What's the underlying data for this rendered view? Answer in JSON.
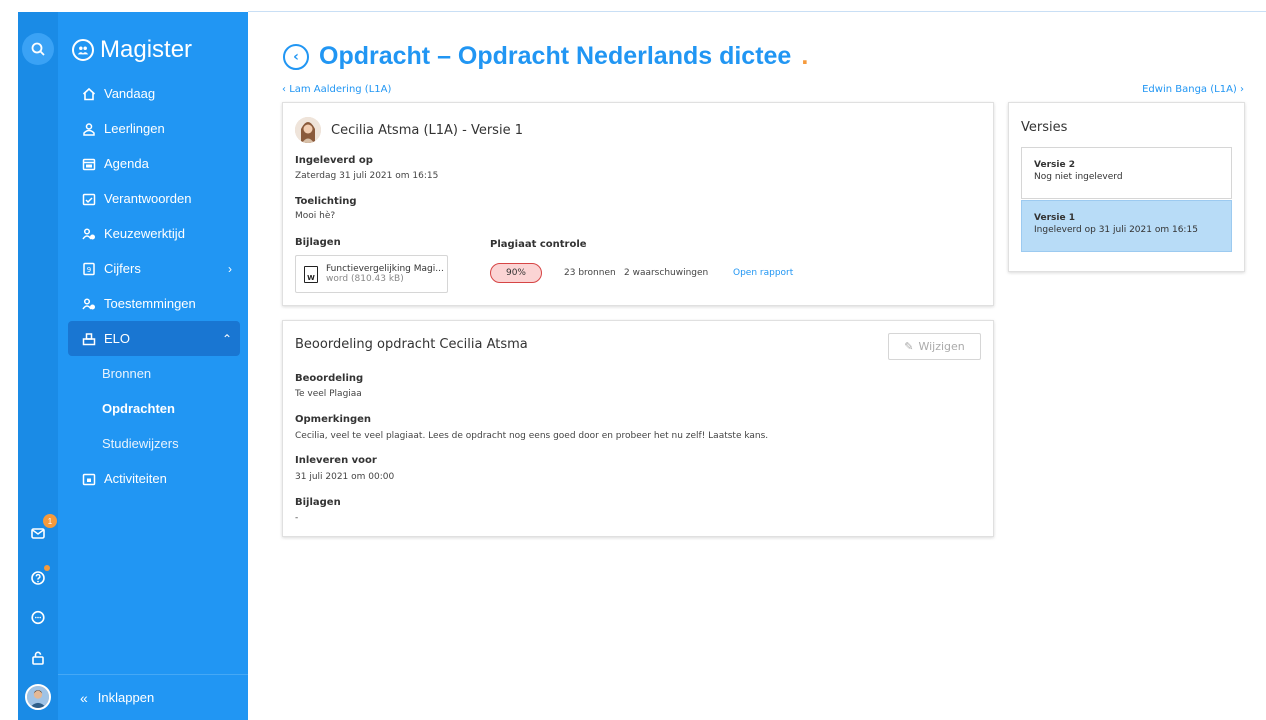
{
  "app": {
    "name": "Magister"
  },
  "sidebar": {
    "items": [
      {
        "label": "Vandaag",
        "icon": "home-icon"
      },
      {
        "label": "Leerlingen",
        "icon": "students-icon"
      },
      {
        "label": "Agenda",
        "icon": "calendar-icon"
      },
      {
        "label": "Verantwoorden",
        "icon": "check-calendar-icon"
      },
      {
        "label": "Keuzewerktijd",
        "icon": "people-icon"
      },
      {
        "label": "Cijfers",
        "icon": "grades-icon"
      },
      {
        "label": "Toestemmingen",
        "icon": "permissions-icon"
      },
      {
        "label": "ELO",
        "icon": "elo-icon"
      }
    ],
    "elo_sub": [
      "Bronnen",
      "Opdrachten",
      "Studiewijzers"
    ],
    "activities": "Activiteiten",
    "collapse": "Inklappen"
  },
  "rail": {
    "mail_badge": "1"
  },
  "page": {
    "title": "Opdracht – Opdracht Nederlands dictee",
    "title_dot": ".",
    "prev_student": "Lam Aaldering (L1A)",
    "next_student": "Edwin Banga (L1A)"
  },
  "submission": {
    "heading": "Cecilia Atsma (L1A) - Versie 1",
    "submitted_label": "Ingeleverd op",
    "submitted_value": "Zaterdag 31 juli 2021 om 16:15",
    "explanation_label": "Toelichting",
    "explanation_value": "Mooi hè?",
    "attachments_label": "Bijlagen",
    "attachment_name": "Functievergelijking Magi...",
    "attachment_size": "word (810.43 kB)",
    "plagiarism_label": "Plagiaat controle",
    "plagiarism_percent": "90%",
    "sources": "23 bronnen",
    "warnings": "2 waarschuwingen",
    "report_link": "Open rapport"
  },
  "assessment": {
    "heading": "Beoordeling opdracht Cecilia Atsma",
    "edit_label": "Wijzigen",
    "grade_label": "Beoordeling",
    "grade_value": "Te veel Plagiaa",
    "remarks_label": "Opmerkingen",
    "remarks_value": "Cecilia, veel te veel plagiaat. Lees de opdracht nog eens goed door en probeer het nu zelf! Laatste kans.",
    "deadline_label": "Inleveren voor",
    "deadline_value": "31 juli 2021 om 00:00",
    "attachments_label": "Bijlagen",
    "attachments_value": "-"
  },
  "versions": {
    "title": "Versies",
    "items": [
      {
        "title": "Versie 2",
        "status": "Nog niet ingeleverd"
      },
      {
        "title": "Versie 1",
        "status": "Ingeleverd op 31 juli 2021 om 16:15"
      }
    ]
  },
  "colors": {
    "primary": "#2196f3",
    "rail": "#1a8be6",
    "accent": "#f59a3c",
    "selected": "#b8dcf7"
  }
}
